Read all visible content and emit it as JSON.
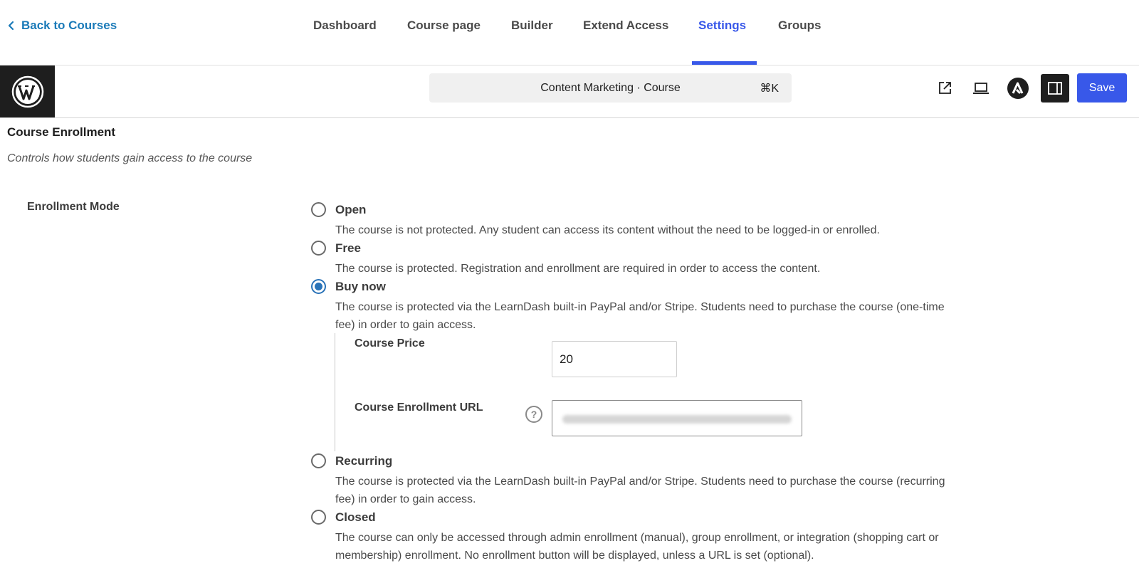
{
  "topnav": {
    "back_label": "Back to Courses",
    "tabs": [
      {
        "label": "Dashboard"
      },
      {
        "label": "Course page"
      },
      {
        "label": "Builder"
      },
      {
        "label": "Extend Access"
      },
      {
        "label": "Settings",
        "active": true
      },
      {
        "label": "Groups"
      }
    ]
  },
  "editor": {
    "command_text": "Content Marketing · Course",
    "command_shortcut": "⌘K",
    "save_label": "Save",
    "icons": [
      "external-link-icon",
      "desktop-preview-icon",
      "astra-icon",
      "sidebar-toggle-icon"
    ]
  },
  "section": {
    "title": "Course Enrollment",
    "description": "Controls how students gain access to the course"
  },
  "enrollment": {
    "label": "Enrollment Mode",
    "selected": "Buy now",
    "options": [
      {
        "label": "Open",
        "desc": "The course is not protected. Any student can access its content without the need to be logged-in or enrolled."
      },
      {
        "label": "Free",
        "desc": "The course is protected. Registration and enrollment are required in order to access the content."
      },
      {
        "label": "Buy now",
        "desc": "The course is protected via the LearnDash built-in PayPal and/or Stripe. Students need to purchase the course (one-time fee) in order to gain access."
      },
      {
        "label": "Recurring",
        "desc": "The course is protected via the LearnDash built-in PayPal and/or Stripe. Students need to purchase the course (recurring fee) in order to gain access."
      },
      {
        "label": "Closed",
        "desc": "The course can only be accessed through admin enrollment (manual), group enrollment, or integration (shopping cart or membership) enrollment. No enrollment button will be displayed, unless a URL is set (optional)."
      }
    ],
    "price_label": "Course Price",
    "price_value": "20",
    "url_label": "Course Enrollment URL",
    "help_glyph": "?"
  },
  "colors": {
    "accent": "#3858e9",
    "link": "#1a7ab8",
    "radio_checked": "#2a73b8"
  }
}
